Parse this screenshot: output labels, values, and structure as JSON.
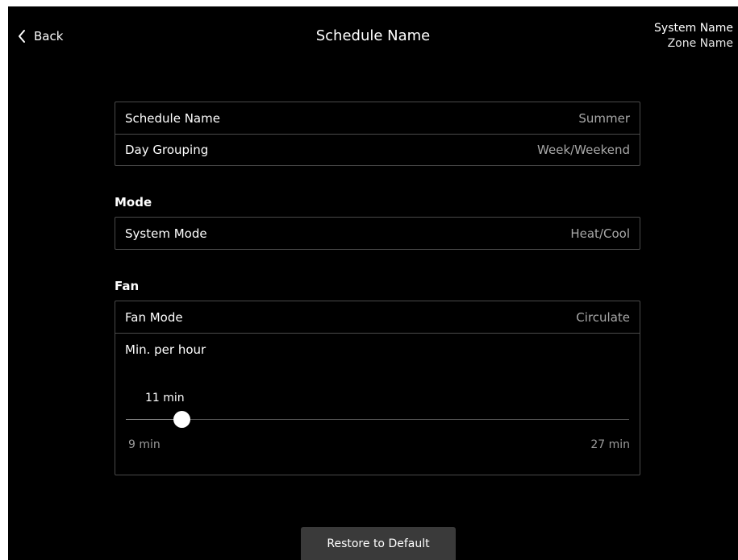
{
  "header": {
    "back_label": "Back",
    "title": "Schedule Name",
    "system_name": "System Name",
    "zone_name": "Zone Name"
  },
  "schedule": {
    "rows": [
      {
        "label": "Schedule Name",
        "value": "Summer"
      },
      {
        "label": "Day Grouping",
        "value": "Week/Weekend"
      }
    ]
  },
  "mode": {
    "heading": "Mode",
    "system_mode_label": "System Mode",
    "system_mode_value": "Heat/Cool"
  },
  "fan": {
    "heading": "Fan",
    "fan_mode_label": "Fan Mode",
    "fan_mode_value": "Circulate",
    "slider": {
      "title": "Min. per hour",
      "current_label": "11 min",
      "value": 11,
      "min": 9,
      "max": 27,
      "min_label": "9 min",
      "max_label": "27 min"
    }
  },
  "footer": {
    "restore_label": "Restore to Default"
  },
  "icons": {
    "back": "chevron-left-icon"
  },
  "colors": {
    "background": "#000000",
    "border": "#4a4a4a",
    "value_text": "#a8a8a8",
    "button": "#3a3a3a"
  }
}
